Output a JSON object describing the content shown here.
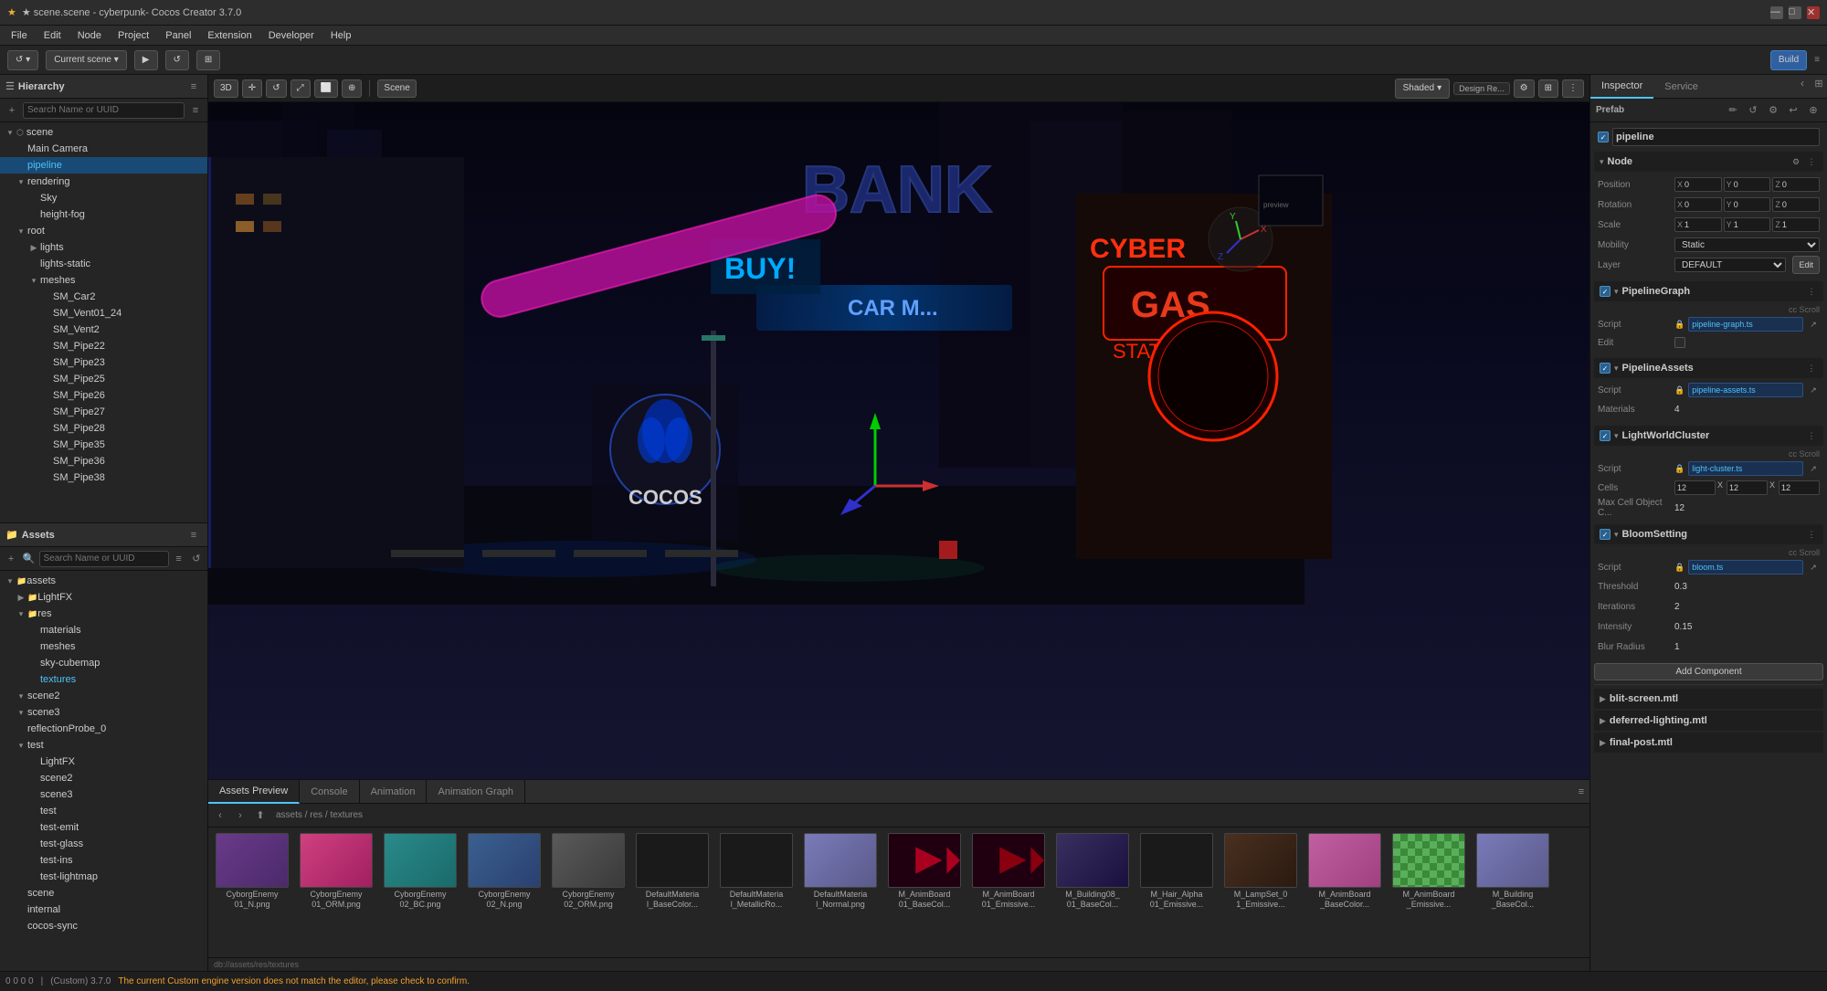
{
  "titlebar": {
    "title": "★ scene.scene - cyberpunk- Cocos Creator 3.7.0",
    "minimize": "—",
    "maximize": "□",
    "close": "✕"
  },
  "menubar": {
    "items": [
      "File",
      "Edit",
      "Node",
      "Project",
      "Panel",
      "Extension",
      "Developer",
      "Help"
    ]
  },
  "toolbar": {
    "scene_label": "Current scene",
    "build_label": "Build"
  },
  "hierarchy": {
    "panel_title": "Hierarchy",
    "search_placeholder": "Search Name or UUID",
    "tree": [
      {
        "label": "scene",
        "level": 0,
        "expanded": true
      },
      {
        "label": "Main Camera",
        "level": 1
      },
      {
        "label": "pipeline",
        "level": 1,
        "selected": true
      },
      {
        "label": "rendering",
        "level": 1,
        "expanded": true
      },
      {
        "label": "Sky",
        "level": 2
      },
      {
        "label": "height-fog",
        "level": 2
      },
      {
        "label": "root",
        "level": 1,
        "expanded": true
      },
      {
        "label": "lights",
        "level": 2,
        "expanded": false
      },
      {
        "label": "lights-static",
        "level": 2
      },
      {
        "label": "meshes",
        "level": 2,
        "expanded": true
      },
      {
        "label": "SM_Car2",
        "level": 3
      },
      {
        "label": "SM_Vent01_24",
        "level": 3
      },
      {
        "label": "SM_Vent2",
        "level": 3
      },
      {
        "label": "SM_Pipe22",
        "level": 3
      },
      {
        "label": "SM_Pipe23",
        "level": 3
      },
      {
        "label": "SM_Pipe25",
        "level": 3
      },
      {
        "label": "SM_Pipe26",
        "level": 3
      },
      {
        "label": "SM_Pipe27",
        "level": 3
      },
      {
        "label": "SM_Pipe28",
        "level": 3
      },
      {
        "label": "SM_Pipe35",
        "level": 3
      },
      {
        "label": "SM_Pipe36",
        "level": 3
      },
      {
        "label": "SM_Pipe38",
        "level": 3
      }
    ]
  },
  "scene_view": {
    "panel_title": "Scene",
    "mode_3d": "3D",
    "shaded_label": "Shaded",
    "design_label": "Design Re..."
  },
  "assets_panel": {
    "panel_title": "Assets Preview",
    "tabs": [
      "Assets Preview",
      "Console",
      "Animation",
      "Animation Graph"
    ],
    "active_tab": "Assets Preview",
    "path": "assets / res / textures",
    "grid_items": [
      {
        "name": "CyborgEnemy01_N.png",
        "thumb_class": "thumb-purple"
      },
      {
        "name": "CyborgEnemy01_ORM.png",
        "thumb_class": "thumb-pink"
      },
      {
        "name": "CyborgEnemy02_BC.png",
        "thumb_class": "thumb-teal"
      },
      {
        "name": "CyborgEnemy02_N.png",
        "thumb_class": "thumb-blue"
      },
      {
        "name": "CyborgEnemy02_ORM.png",
        "thumb_class": "thumb-gray"
      },
      {
        "name": "DefaultMaterial_BaseColor...",
        "thumb_class": "thumb-dark"
      },
      {
        "name": "DefaultMaterial_MetallicRo...",
        "thumb_class": "thumb-dark"
      },
      {
        "name": "DefaultMaterial_Normal.png",
        "thumb_class": "thumb-lavender"
      },
      {
        "name": "M_AnimBoard01_BaseCol...",
        "thumb_class": "thumb-red"
      },
      {
        "name": "M_AnimBoard01_Emissive...",
        "thumb_class": "thumb-red"
      },
      {
        "name": "M_Building08_01_BaseCol...",
        "thumb_class": "thumb-building"
      },
      {
        "name": "M_Hair_Alpha01_Emissive...",
        "thumb_class": "thumb-dark"
      },
      {
        "name": "M_LampSet_01_Emissive...",
        "thumb_class": "thumb-lamp"
      },
      {
        "name": "M_AnimBoard_BaseColor...",
        "thumb_class": "thumb-pink2"
      },
      {
        "name": "M_AnimBoard_Emissive...",
        "thumb_class": "thumb-mixed"
      },
      {
        "name": "M_Building_BaseCol...",
        "thumb_class": "thumb-building"
      }
    ],
    "db_path": "db://assets/res/textures"
  },
  "inspector": {
    "tabs": [
      "Inspector",
      "Service"
    ],
    "active_tab": "Inspector",
    "prefab_label": "Prefab",
    "node_name": "pipeline",
    "sections": {
      "node": {
        "title": "Node",
        "position": {
          "x": "0",
          "y": "0",
          "z": "0"
        },
        "rotation": {
          "x": "0",
          "y": "0",
          "z": "0"
        },
        "scale": {
          "x": "1",
          "y": "1",
          "z": "1"
        },
        "mobility": "Static",
        "layer": "DEFAULT"
      },
      "pipeline_graph": {
        "title": "PipelineGraph",
        "script_label": "Script",
        "script_value": "pipeline-graph.ts",
        "edit_label": "Edit"
      },
      "pipeline_assets": {
        "title": "PipelineAssets",
        "script_label": "Script",
        "script_value": "pipeline-assets.ts",
        "materials_label": "Materials",
        "materials_value": "4"
      },
      "light_world_cluster": {
        "title": "LightWorldCluster",
        "script_label": "Script",
        "script_value": "light-cluster.ts",
        "cells_label": "Cells",
        "cells_x": "12",
        "cells_y": "12",
        "cells_z": "12",
        "max_cell_label": "Max Cell Object C...",
        "max_cell_value": "12"
      },
      "bloom_setting": {
        "title": "BloomSetting",
        "script_label": "Script",
        "script_value": "bloom.ts",
        "threshold_label": "Threshold",
        "threshold_value": "0.3",
        "iterations_label": "Iterations",
        "iterations_value": "2",
        "intensity_label": "Intensity",
        "intensity_value": "0.15",
        "blur_radius_label": "Blur Radius",
        "blur_radius_value": "1"
      },
      "add_component": "Add Component"
    },
    "collapsed_sections": [
      {
        "label": "blit-screen.mtl"
      },
      {
        "label": "deferred-lighting.mtl"
      },
      {
        "label": "final-post.mtl"
      }
    ]
  },
  "assets_tree": {
    "search_placeholder": "Search Name or UUID",
    "items": [
      {
        "label": "assets",
        "level": 0,
        "expanded": true
      },
      {
        "label": "LightFX",
        "level": 1
      },
      {
        "label": "res",
        "level": 1,
        "expanded": true
      },
      {
        "label": "materials",
        "level": 2
      },
      {
        "label": "meshes",
        "level": 2
      },
      {
        "label": "sky-cubemap",
        "level": 2
      },
      {
        "label": "textures",
        "level": 2
      },
      {
        "label": "scene2",
        "level": 1,
        "expanded": false
      },
      {
        "label": "scene3",
        "level": 1,
        "expanded": false
      },
      {
        "label": "reflectionProbe_0",
        "level": 1
      },
      {
        "label": "test",
        "level": 1,
        "expanded": true
      },
      {
        "label": "LightFX",
        "level": 2
      },
      {
        "label": "scene2",
        "level": 2
      },
      {
        "label": "scene3",
        "level": 2
      },
      {
        "label": "test",
        "level": 2
      },
      {
        "label": "test-emit",
        "level": 2
      },
      {
        "label": "test-glass",
        "level": 2
      },
      {
        "label": "test-ins",
        "level": 2
      },
      {
        "label": "test-lightmap",
        "level": 2
      },
      {
        "label": "scene",
        "level": 1
      },
      {
        "label": "internal",
        "level": 1
      },
      {
        "label": "cocos-sync",
        "level": 1
      }
    ]
  },
  "status_bar": {
    "coords": "0  0  0  0",
    "engine_info": "(Custom) 3.7.0",
    "warning_text": "The current Custom engine version does not match the editor, please check to confirm."
  }
}
